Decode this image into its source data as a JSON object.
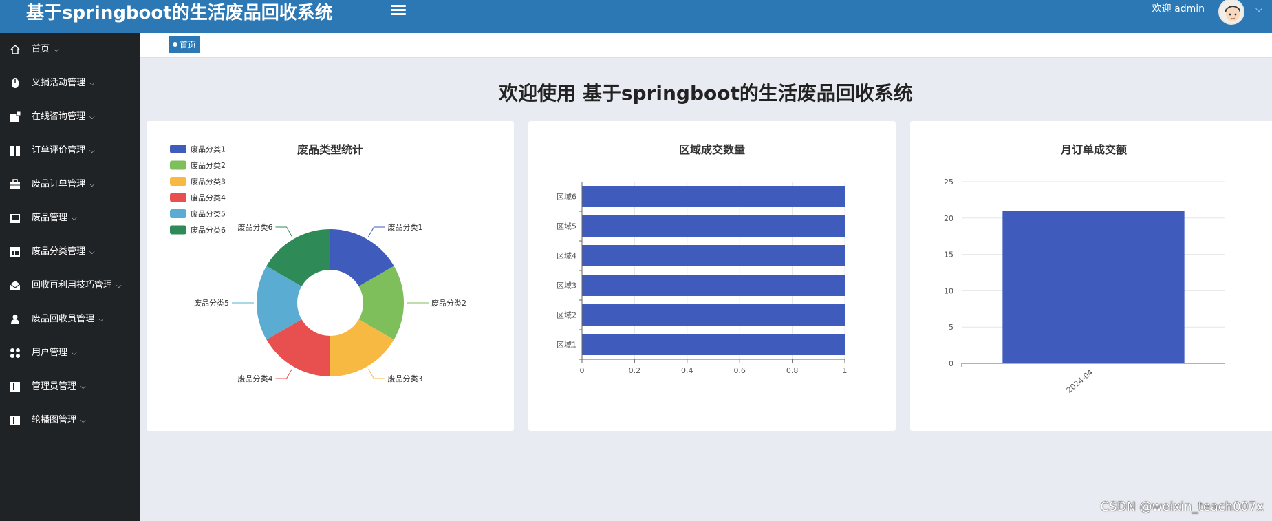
{
  "header": {
    "app_title": "基于springboot的生活废品回收系统",
    "welcome_text": "欢迎 admin",
    "caret": "⌵"
  },
  "sidebar": {
    "items": [
      {
        "label": "首页",
        "icon": "home-icon"
      },
      {
        "label": "义捐活动管理",
        "icon": "mouse-icon"
      },
      {
        "label": "在线咨询管理",
        "icon": "note-icon"
      },
      {
        "label": "订单评价管理",
        "icon": "columns-icon"
      },
      {
        "label": "废品订单管理",
        "icon": "briefcase-icon"
      },
      {
        "label": "废品管理",
        "icon": "tray-icon"
      },
      {
        "label": "废品分类管理",
        "icon": "layout-icon"
      },
      {
        "label": "回收再利用技巧管理",
        "icon": "envelope-icon"
      },
      {
        "label": "废品回收员管理",
        "icon": "person-icon"
      },
      {
        "label": "用户管理",
        "icon": "users-icon"
      },
      {
        "label": "管理员管理",
        "icon": "book-icon"
      },
      {
        "label": "轮播图管理",
        "icon": "book-icon"
      }
    ],
    "caret": "⌵"
  },
  "tabs": {
    "home_label": "首页"
  },
  "main": {
    "title": "欢迎使用 基于springboot的生活废品回收系统"
  },
  "colors": {
    "header": "#2b78b5",
    "sidebar": "#202326",
    "bar": "#3f5bbc"
  },
  "watermark": "CSDN @weixin_teach007x",
  "chart_data": [
    {
      "type": "pie",
      "title": "废品类型统计",
      "categories": [
        "废品分类1",
        "废品分类2",
        "废品分类3",
        "废品分类4",
        "废品分类5",
        "废品分类6"
      ],
      "values": [
        1,
        1,
        1,
        1,
        1,
        1
      ],
      "colors": [
        "#3f5bbc",
        "#7ebf5b",
        "#f7b941",
        "#e8504f",
        "#5aacd3",
        "#2e8b57"
      ],
      "donut": true,
      "legend": "top-left"
    },
    {
      "type": "bar",
      "orientation": "horizontal",
      "title": "区域成交数量",
      "categories": [
        "区域1",
        "区域2",
        "区域3",
        "区域4",
        "区域5",
        "区域6"
      ],
      "values": [
        1,
        1,
        1,
        1,
        1,
        1
      ],
      "xlim": [
        0,
        1
      ],
      "ticks": [
        "0",
        "0.2",
        "0.4",
        "0.6",
        "0.8",
        "1"
      ],
      "grid": true
    },
    {
      "type": "bar",
      "title": "月订单成交额",
      "categories": [
        "2024-04"
      ],
      "values": [
        21
      ],
      "ylim": [
        0,
        25
      ],
      "ticks": [
        "0",
        "5",
        "10",
        "15",
        "20",
        "25"
      ],
      "grid": true
    }
  ]
}
